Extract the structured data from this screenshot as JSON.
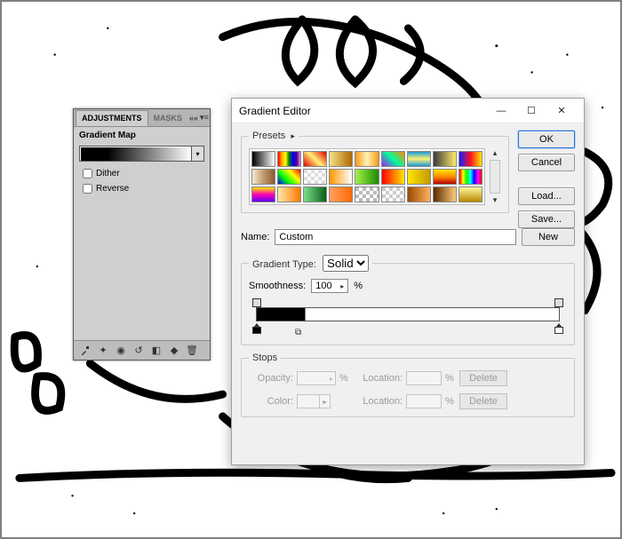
{
  "adjustments_panel": {
    "tab_active": "ADJUSTMENTS",
    "tab_inactive": "MASKS",
    "title": "Gradient Map",
    "dither_label": "Dither",
    "reverse_label": "Reverse",
    "dither_checked": false,
    "reverse_checked": false,
    "footer_icons": [
      "eyedropper-icon",
      "pin-icon",
      "eye-icon",
      "reset-icon",
      "new-adjustment-icon",
      "clip-icon",
      "trash-icon"
    ]
  },
  "gradient_editor": {
    "window_title": "Gradient Editor",
    "buttons": {
      "ok": "OK",
      "cancel": "Cancel",
      "load": "Load...",
      "save": "Save...",
      "new": "New"
    },
    "presets_label": "Presets",
    "presets": [
      "linear-gradient(to right,#000,#fff)",
      "linear-gradient(to right,red,orange,yellow,green,blue,indigo,violet)",
      "linear-gradient(45deg,#d00,#fff176,#d00)",
      "linear-gradient(to right,#f3e08a,#b06a00)",
      "linear-gradient(to right,#f79a1a,#fff2b2,#f79a1a)",
      "linear-gradient(45deg,#a020f0,#00ff9c,#ff8a00)",
      "linear-gradient(to bottom,#1a9bd8,#fff176,#1a9bd8)",
      "linear-gradient(to right,#3a3a3a,#ffeb6a)",
      "linear-gradient(to right,#1020ff,#ff1020,#ffe600)",
      "linear-gradient(to right,#f4ead2,#c49a6c,#8b5a2b)",
      "linear-gradient(45deg,#0000ff,#00ff00,#ffff00,#ff0000)",
      "repeating-conic-gradient(#ddd 0 25%,#fff 0 50%)",
      "linear-gradient(to right,#ff9900,rgba(255,153,0,0))",
      "linear-gradient(to right,#a3f24a,#1a8a00)",
      "linear-gradient(to right,#ff0000,#ffe600)",
      "linear-gradient(to right,#ffe600,#c49a00)",
      "linear-gradient(to bottom,#ffe600,#ff8a00,#b80000)",
      "linear-gradient(to right,#ff0000,#ffff00,#00ff00,#00ffff,#0000ff,#ff00ff,#ff0000)",
      "linear-gradient(to bottom,#ffe600,#ff00b0,#5a00ff)",
      "linear-gradient(to right,#ffe9a8,#ff7a00)",
      "linear-gradient(to right,#7adf8a,#0a5f1a)",
      "linear-gradient(to right,#ffa060,#ff6a00)",
      "repeating-conic-gradient(#bbb 0 25%,#fff 0 50%)",
      "repeating-conic-gradient(#ccc 0 25%,#fff 0 50%)",
      "linear-gradient(to right,#9b4a00,#ffb060)",
      "linear-gradient(to right,#5a2a00,#ffcc7a)",
      "linear-gradient(to bottom,#fff6a0,#b88a00)"
    ],
    "name_label": "Name:",
    "name_value": "Custom",
    "gradient_type_label": "Gradient Type:",
    "gradient_type_value": "Solid",
    "smooth_label": "Smoothness:",
    "smooth_value": "100",
    "smooth_unit": "%",
    "stops_label": "Stops",
    "opacity_label": "Opacity:",
    "color_label": "Color:",
    "location_label": "Location:",
    "delete_label": "Delete",
    "percent": "%"
  }
}
